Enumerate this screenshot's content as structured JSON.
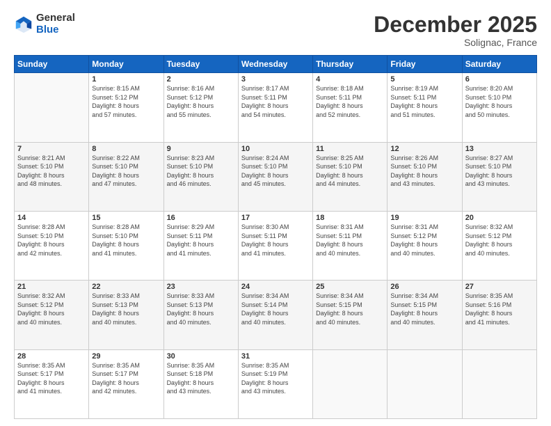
{
  "logo": {
    "general": "General",
    "blue": "Blue"
  },
  "title": "December 2025",
  "subtitle": "Solignac, France",
  "weekdays": [
    "Sunday",
    "Monday",
    "Tuesday",
    "Wednesday",
    "Thursday",
    "Friday",
    "Saturday"
  ],
  "weeks": [
    [
      {
        "day": "",
        "info": ""
      },
      {
        "day": "1",
        "info": "Sunrise: 8:15 AM\nSunset: 5:12 PM\nDaylight: 8 hours\nand 57 minutes."
      },
      {
        "day": "2",
        "info": "Sunrise: 8:16 AM\nSunset: 5:12 PM\nDaylight: 8 hours\nand 55 minutes."
      },
      {
        "day": "3",
        "info": "Sunrise: 8:17 AM\nSunset: 5:11 PM\nDaylight: 8 hours\nand 54 minutes."
      },
      {
        "day": "4",
        "info": "Sunrise: 8:18 AM\nSunset: 5:11 PM\nDaylight: 8 hours\nand 52 minutes."
      },
      {
        "day": "5",
        "info": "Sunrise: 8:19 AM\nSunset: 5:11 PM\nDaylight: 8 hours\nand 51 minutes."
      },
      {
        "day": "6",
        "info": "Sunrise: 8:20 AM\nSunset: 5:10 PM\nDaylight: 8 hours\nand 50 minutes."
      }
    ],
    [
      {
        "day": "7",
        "info": "Sunrise: 8:21 AM\nSunset: 5:10 PM\nDaylight: 8 hours\nand 48 minutes."
      },
      {
        "day": "8",
        "info": "Sunrise: 8:22 AM\nSunset: 5:10 PM\nDaylight: 8 hours\nand 47 minutes."
      },
      {
        "day": "9",
        "info": "Sunrise: 8:23 AM\nSunset: 5:10 PM\nDaylight: 8 hours\nand 46 minutes."
      },
      {
        "day": "10",
        "info": "Sunrise: 8:24 AM\nSunset: 5:10 PM\nDaylight: 8 hours\nand 45 minutes."
      },
      {
        "day": "11",
        "info": "Sunrise: 8:25 AM\nSunset: 5:10 PM\nDaylight: 8 hours\nand 44 minutes."
      },
      {
        "day": "12",
        "info": "Sunrise: 8:26 AM\nSunset: 5:10 PM\nDaylight: 8 hours\nand 43 minutes."
      },
      {
        "day": "13",
        "info": "Sunrise: 8:27 AM\nSunset: 5:10 PM\nDaylight: 8 hours\nand 43 minutes."
      }
    ],
    [
      {
        "day": "14",
        "info": "Sunrise: 8:28 AM\nSunset: 5:10 PM\nDaylight: 8 hours\nand 42 minutes."
      },
      {
        "day": "15",
        "info": "Sunrise: 8:28 AM\nSunset: 5:10 PM\nDaylight: 8 hours\nand 41 minutes."
      },
      {
        "day": "16",
        "info": "Sunrise: 8:29 AM\nSunset: 5:11 PM\nDaylight: 8 hours\nand 41 minutes."
      },
      {
        "day": "17",
        "info": "Sunrise: 8:30 AM\nSunset: 5:11 PM\nDaylight: 8 hours\nand 41 minutes."
      },
      {
        "day": "18",
        "info": "Sunrise: 8:31 AM\nSunset: 5:11 PM\nDaylight: 8 hours\nand 40 minutes."
      },
      {
        "day": "19",
        "info": "Sunrise: 8:31 AM\nSunset: 5:12 PM\nDaylight: 8 hours\nand 40 minutes."
      },
      {
        "day": "20",
        "info": "Sunrise: 8:32 AM\nSunset: 5:12 PM\nDaylight: 8 hours\nand 40 minutes."
      }
    ],
    [
      {
        "day": "21",
        "info": "Sunrise: 8:32 AM\nSunset: 5:12 PM\nDaylight: 8 hours\nand 40 minutes."
      },
      {
        "day": "22",
        "info": "Sunrise: 8:33 AM\nSunset: 5:13 PM\nDaylight: 8 hours\nand 40 minutes."
      },
      {
        "day": "23",
        "info": "Sunrise: 8:33 AM\nSunset: 5:13 PM\nDaylight: 8 hours\nand 40 minutes."
      },
      {
        "day": "24",
        "info": "Sunrise: 8:34 AM\nSunset: 5:14 PM\nDaylight: 8 hours\nand 40 minutes."
      },
      {
        "day": "25",
        "info": "Sunrise: 8:34 AM\nSunset: 5:15 PM\nDaylight: 8 hours\nand 40 minutes."
      },
      {
        "day": "26",
        "info": "Sunrise: 8:34 AM\nSunset: 5:15 PM\nDaylight: 8 hours\nand 40 minutes."
      },
      {
        "day": "27",
        "info": "Sunrise: 8:35 AM\nSunset: 5:16 PM\nDaylight: 8 hours\nand 41 minutes."
      }
    ],
    [
      {
        "day": "28",
        "info": "Sunrise: 8:35 AM\nSunset: 5:17 PM\nDaylight: 8 hours\nand 41 minutes."
      },
      {
        "day": "29",
        "info": "Sunrise: 8:35 AM\nSunset: 5:17 PM\nDaylight: 8 hours\nand 42 minutes."
      },
      {
        "day": "30",
        "info": "Sunrise: 8:35 AM\nSunset: 5:18 PM\nDaylight: 8 hours\nand 43 minutes."
      },
      {
        "day": "31",
        "info": "Sunrise: 8:35 AM\nSunset: 5:19 PM\nDaylight: 8 hours\nand 43 minutes."
      },
      {
        "day": "",
        "info": ""
      },
      {
        "day": "",
        "info": ""
      },
      {
        "day": "",
        "info": ""
      }
    ]
  ]
}
